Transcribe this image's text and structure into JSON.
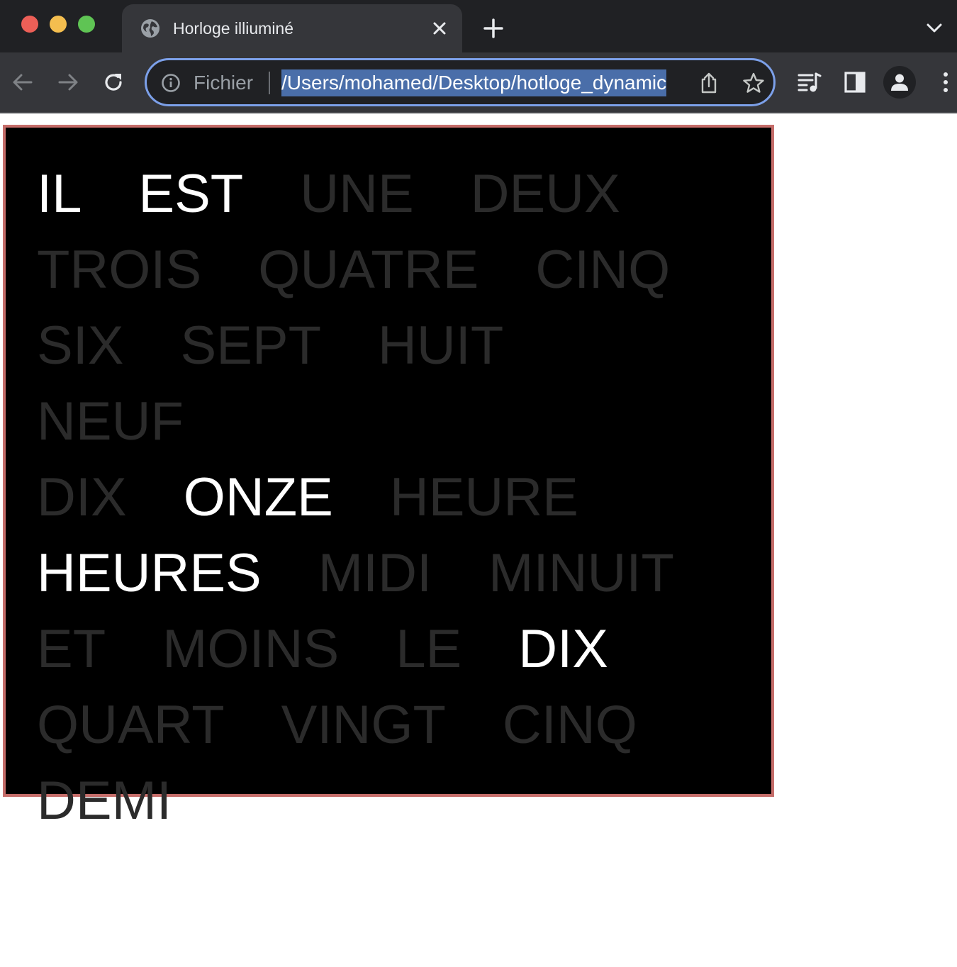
{
  "browser": {
    "tab_title": "Horloge illiuminé",
    "scheme_label": "Fichier",
    "url": "/Users/mohamed/Desktop/hotloge_dynamic",
    "icons": {
      "favicon": "globe-icon",
      "close": "close-icon",
      "new_tab": "plus-icon",
      "tab_search": "chevron-down-icon",
      "back": "back-arrow-icon",
      "forward": "forward-arrow-icon",
      "reload": "reload-icon",
      "site_info": "info-icon",
      "share": "share-icon",
      "bookmark": "star-icon",
      "media": "media-control-icon",
      "side_panel": "side-panel-icon",
      "profile": "profile-icon",
      "menu": "more-vert-icon"
    }
  },
  "clock": {
    "lit_color": "#ffffff",
    "dim_color": "#2b2b2b",
    "background": "#000000",
    "border_color": "#c56d6a",
    "words": [
      {
        "text": "IL",
        "lit": true
      },
      {
        "text": "EST",
        "lit": true
      },
      {
        "text": "UNE",
        "lit": false
      },
      {
        "text": "DEUX",
        "lit": false
      },
      {
        "text": "TROIS",
        "lit": false
      },
      {
        "text": "QUATRE",
        "lit": false
      },
      {
        "text": "CINQ",
        "lit": false
      },
      {
        "text": "SIX",
        "lit": false
      },
      {
        "text": "SEPT",
        "lit": false
      },
      {
        "text": "HUIT",
        "lit": false
      },
      {
        "text": "NEUF",
        "lit": false
      },
      {
        "text": "DIX",
        "lit": false
      },
      {
        "text": "ONZE",
        "lit": true
      },
      {
        "text": "HEURE",
        "lit": false
      },
      {
        "text": "HEURES",
        "lit": true
      },
      {
        "text": "MIDI",
        "lit": false
      },
      {
        "text": "MINUIT",
        "lit": false
      },
      {
        "text": "ET",
        "lit": false
      },
      {
        "text": "MOINS",
        "lit": false
      },
      {
        "text": "LE",
        "lit": false
      },
      {
        "text": "DIX",
        "lit": true
      },
      {
        "text": "QUART",
        "lit": false
      },
      {
        "text": "VINGT",
        "lit": false
      },
      {
        "text": "CINQ",
        "lit": false
      },
      {
        "text": "DEMI",
        "lit": false
      }
    ]
  }
}
